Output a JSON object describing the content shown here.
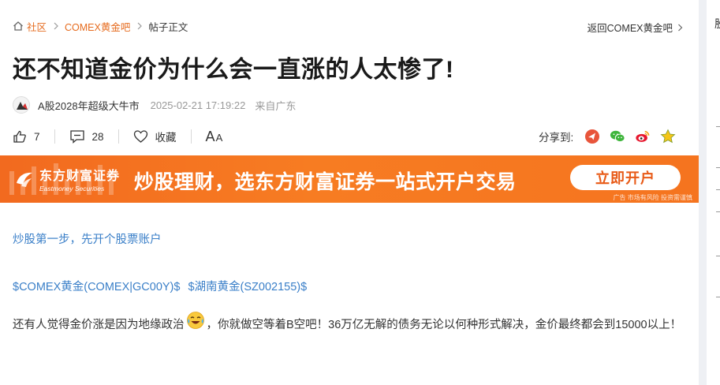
{
  "breadcrumb": {
    "home": "社区",
    "forum": "COMEX黄金吧",
    "current": "帖子正文"
  },
  "back_link": "返回COMEX黄金吧",
  "post": {
    "title": "还不知道金价为什么会一直涨的人太惨了!",
    "author": "A股2028年超级大牛市",
    "time": "2025-02-21 17:19:22",
    "source": "来自广东",
    "likes": "7",
    "comments": "28",
    "favorite_label": "收藏",
    "font_big": "A",
    "font_small": "A"
  },
  "share": {
    "label": "分享到:",
    "targets": [
      "toutiao-icon",
      "wechat-icon",
      "weibo-icon",
      "favorite-star-icon"
    ]
  },
  "banner": {
    "brand_cn": "东方财富证券",
    "brand_en": "Eastmoney Securities",
    "slogan": "炒股理财，选东方财富证券一站式开户交易",
    "cta": "立即开户",
    "disclaimer": "广告 市场有风险 投资需谨慎"
  },
  "content": {
    "open_link": "炒股第一步，先开个股票账户",
    "tags": [
      "$COMEX黄金(COMEX|GC00Y)$",
      "$湖南黄金(SZ002155)$"
    ],
    "text_before_emoji": "还有人觉得金价涨是因为地缘政治",
    "text_after_emoji": "，你就做空等着B空吧！36万亿无解的债务无论以何种形式解决，金价最终都会到15000以上！"
  },
  "sidebar_partial": "股",
  "colors": {
    "accent": "#e66b1e",
    "link": "#3a7fc8",
    "banner": "#f5741f"
  }
}
